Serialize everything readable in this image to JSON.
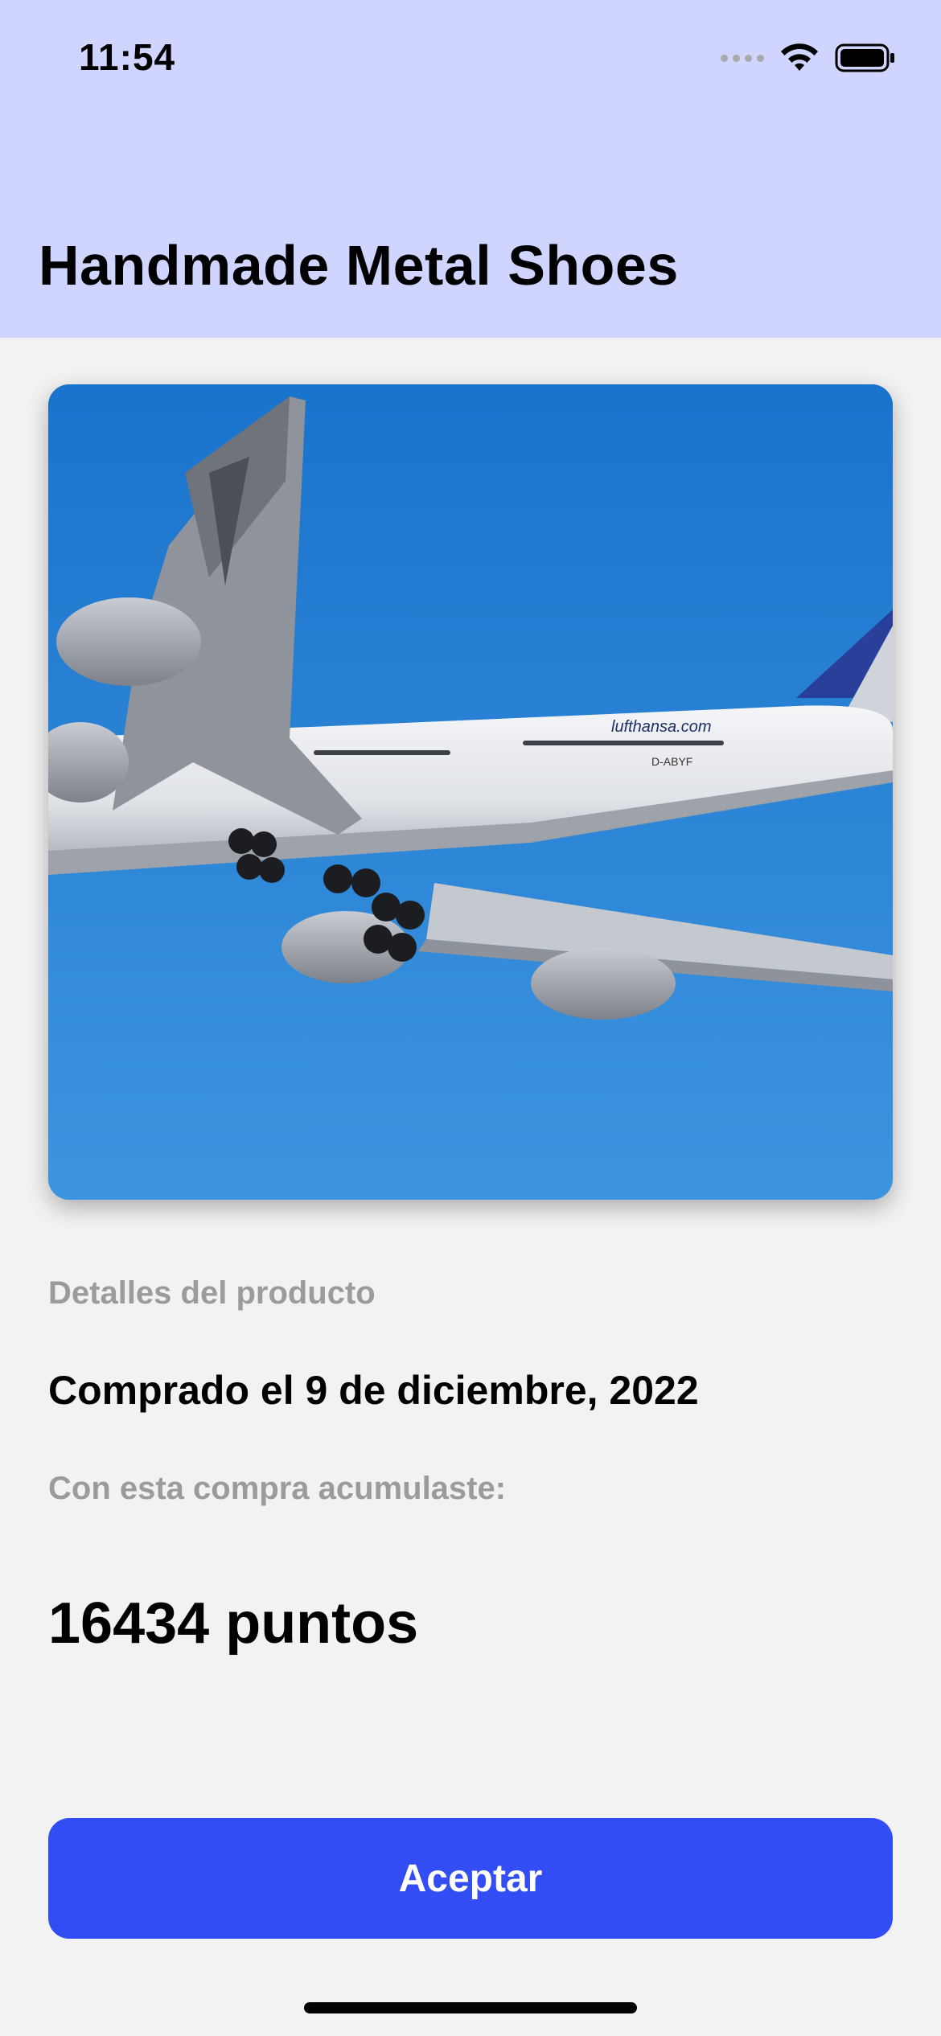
{
  "status_bar": {
    "time": "11:54",
    "icons": [
      "cellular-signal-icon",
      "wifi-icon",
      "battery-icon"
    ]
  },
  "header": {
    "title": "Handmade Metal Shoes",
    "background_color": "#d0d5ff"
  },
  "product_image": {
    "subject": "airplane-photo",
    "airline_text": "lufthansa.com",
    "registration": "D-ABYF"
  },
  "details": {
    "section_label": "Detalles del producto",
    "purchase_date": "Comprado el 9 de diciembre, 2022",
    "accumulated_label": "Con esta compra acumulaste:",
    "points": "16434 puntos"
  },
  "actions": {
    "accept_label": "Aceptar",
    "accent_color": "#334df5"
  }
}
